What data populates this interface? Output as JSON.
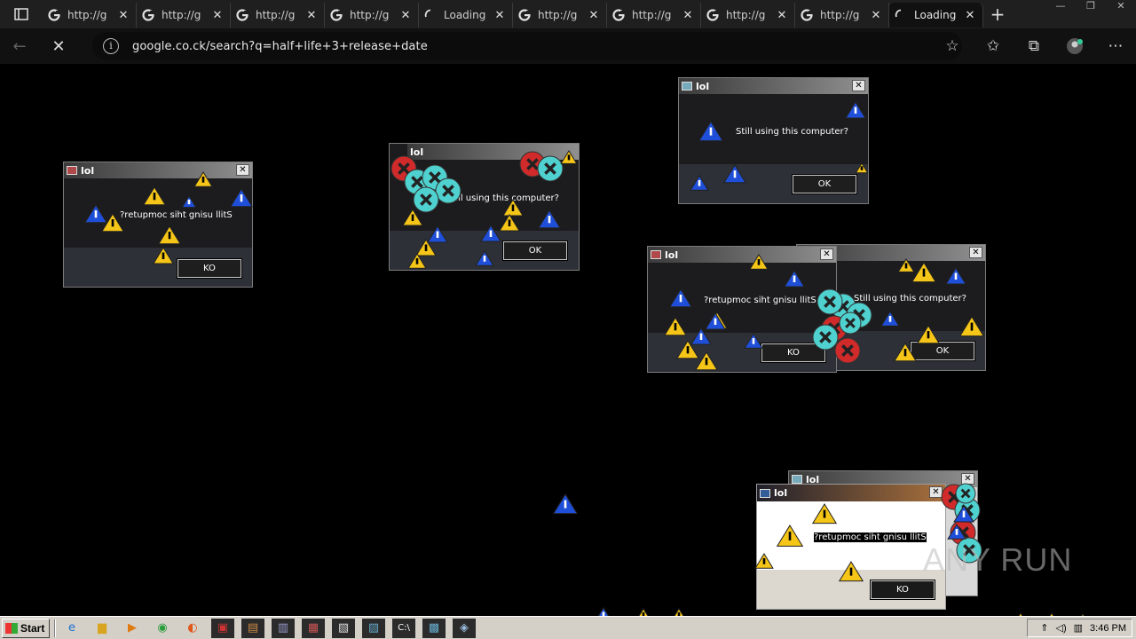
{
  "browser": {
    "tabs": [
      {
        "title": "http://g",
        "icon": "google-icon"
      },
      {
        "title": "http://g",
        "icon": "google-icon"
      },
      {
        "title": "http://g",
        "icon": "google-icon"
      },
      {
        "title": "http://g",
        "icon": "google-icon"
      },
      {
        "title": "Loading",
        "icon": "spinner-icon"
      },
      {
        "title": "http://g",
        "icon": "google-icon"
      },
      {
        "title": "http://g",
        "icon": "google-icon"
      },
      {
        "title": "http://g",
        "icon": "google-icon"
      },
      {
        "title": "http://g",
        "icon": "google-icon"
      },
      {
        "title": "Loading",
        "icon": "spinner-icon"
      }
    ],
    "tab_close": "✕",
    "new_tab": "+",
    "url": "google.co.ck/search?q=half+life+3+release+date"
  },
  "dialogs": {
    "d1": {
      "title": "lol",
      "message": "?retupmoc siht gnisu llitS",
      "button": "KO"
    },
    "d2": {
      "title": "lol",
      "message": "Still using this computer?",
      "button": "OK"
    },
    "d3": {
      "title": "lol",
      "message": "Still using this computer?",
      "button": "OK"
    },
    "d4": {
      "title": "lol",
      "message": "?retupmoc siht gnisu llitS",
      "button": "KO"
    },
    "d5": {
      "title": "",
      "message": "Still using this computer?",
      "button": "OK"
    },
    "d6": {
      "title": "lol",
      "message": "?retupmoc siht gnisu llitS",
      "button": "KO"
    },
    "d7": {
      "title": "lol"
    }
  },
  "taskbar": {
    "start_label": "Start",
    "clock": "3:46 PM"
  },
  "watermark": "ANY RUN",
  "colors": {
    "warning_yellow": "#f5c518",
    "warning_blue": "#1f4fd8",
    "error_teal": "#4fd1cf",
    "error_red": "#d02a2a"
  }
}
